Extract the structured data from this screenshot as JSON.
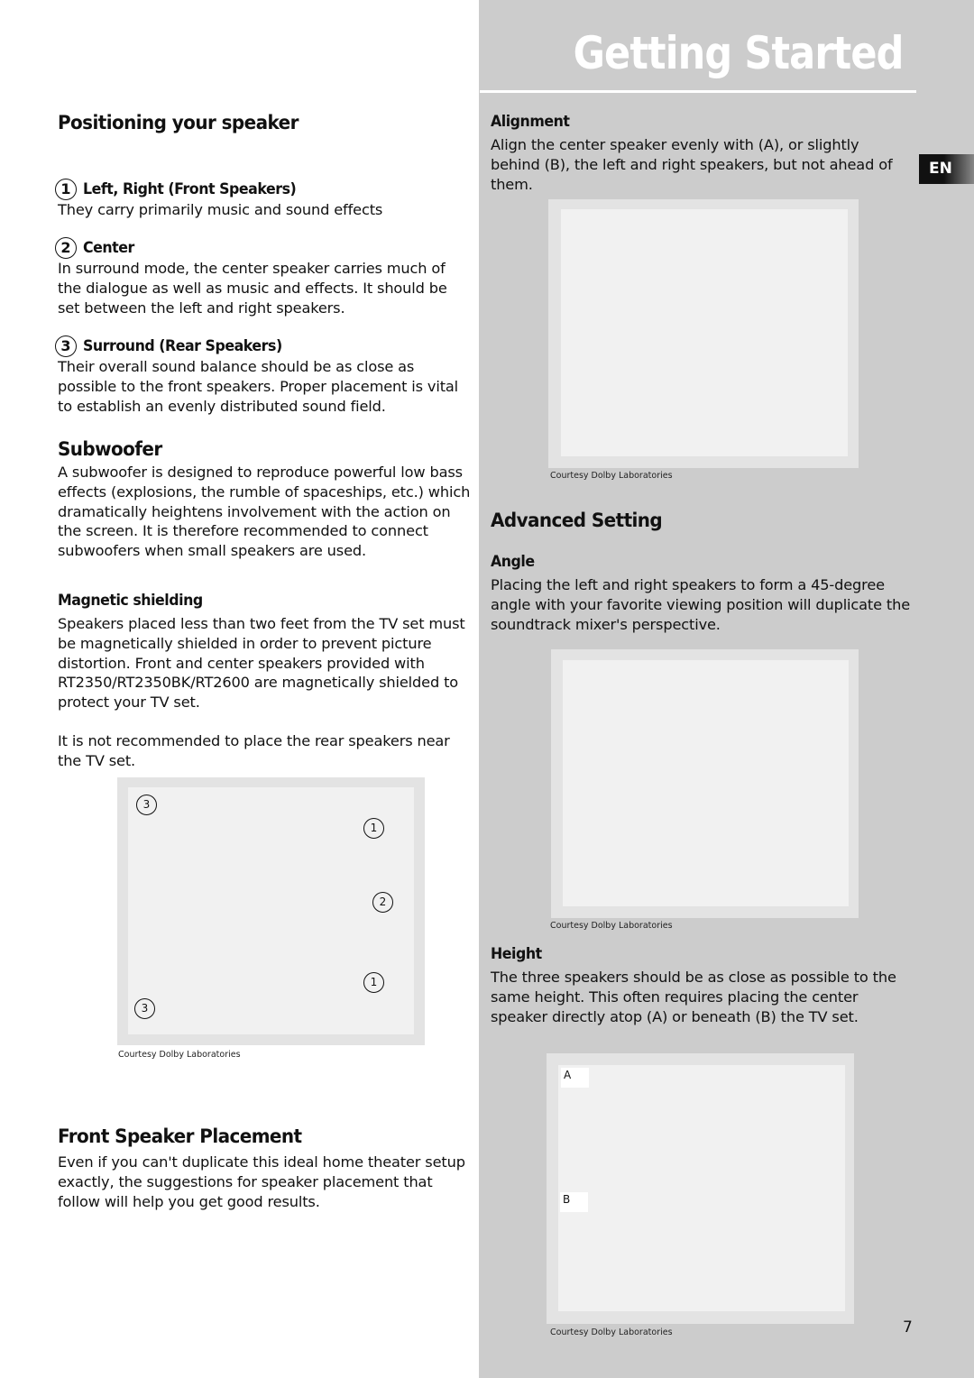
{
  "header": {
    "title": "Getting Started",
    "language_tab": "EN",
    "page_number": "7"
  },
  "left": {
    "positioning": {
      "title": "Positioning your speaker",
      "items": [
        {
          "number": "1",
          "title": "Left, Right (Front Speakers)",
          "text": "They carry primarily music and sound effects"
        },
        {
          "number": "2",
          "title": "Center",
          "text": "In surround mode, the center speaker carries much of the dialogue as well as music and effects. It should be set between the  left and right speakers."
        },
        {
          "number": "3",
          "title": "Surround (Rear Speakers)",
          "text": "Their overall sound balance should be as close as possible to the front speakers. Proper placement is vital to establish an evenly distributed sound field."
        }
      ]
    },
    "subwoofer": {
      "title": "Subwoofer",
      "text": "A subwoofer is designed to reproduce powerful low bass effects (explosions, the rumble of spaceships, etc.) which dramatically heightens involvement with the action on the screen.  It is therefore recommended to connect subwoofers when small speakers are used."
    },
    "magnetic": {
      "title": "Magnetic shielding",
      "text": "Speakers placed less than two feet from the TV set must be magnetically shielded in order to prevent picture distortion. Front and center speakers provided with RT2350/RT2350BK/RT2600 are magnetically shielded to protect your TV set.",
      "note": "It is not recommended to place the rear speakers near the TV set."
    },
    "layout_figure": {
      "markers": [
        "3",
        "1",
        "2",
        "1",
        "3"
      ],
      "caption": "Courtesy Dolby Laboratories"
    },
    "front_placement": {
      "title": "Front Speaker Placement",
      "text": "Even if you can't duplicate this ideal home theater setup exactly, the suggestions for speaker placement that follow will help you get good results."
    }
  },
  "right": {
    "alignment": {
      "title": "Alignment",
      "text": "Align the center speaker evenly with (A), or slightly behind (B), the left and right speakers, but not ahead of them.",
      "caption": "Courtesy Dolby Laboratories"
    },
    "advanced": {
      "title": "Advanced Setting"
    },
    "angle": {
      "title": "Angle",
      "text": "Placing the left and right speakers to form a 45-degree angle with your favorite viewing position will duplicate the soundtrack mixer's perspective.",
      "caption": "Courtesy Dolby Laboratories"
    },
    "height": {
      "title": "Height",
      "text": "The three speakers should be as close as possible to the same height. This often requires placing the center speaker directly atop (A) or beneath (B) the TV set.",
      "labels": [
        "A",
        "B"
      ],
      "caption": "Courtesy Dolby Laboratories"
    }
  }
}
